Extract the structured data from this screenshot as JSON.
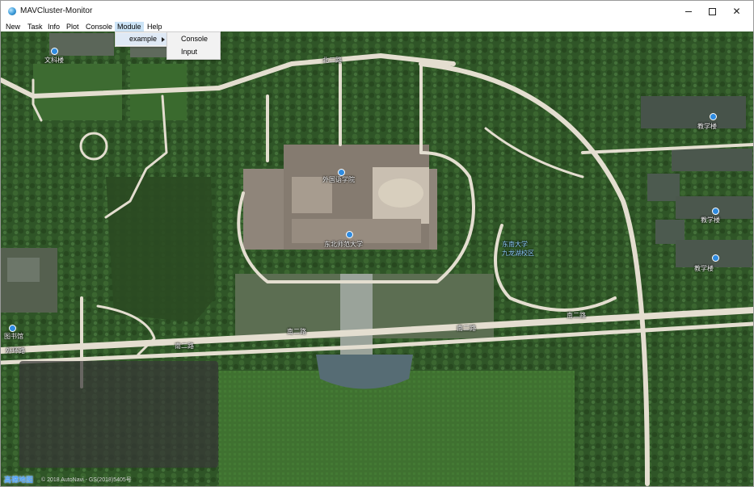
{
  "window": {
    "title": "MAVCluster-Monitor",
    "controls": {
      "minimize": "—",
      "maximize": "☐",
      "close": "✕"
    }
  },
  "menubar": {
    "items": [
      {
        "label": "New"
      },
      {
        "label": "Task"
      },
      {
        "label": "Info"
      },
      {
        "label": "Plot"
      },
      {
        "label": "Console"
      },
      {
        "label": "Module",
        "active": true
      },
      {
        "label": "Help"
      }
    ]
  },
  "module_menu": {
    "items": [
      {
        "label": "example",
        "has_submenu": true
      }
    ],
    "submenu": {
      "items": [
        {
          "label": "Console"
        },
        {
          "label": "Input"
        }
      ]
    }
  },
  "map": {
    "labels": {
      "building_left": "文科楼",
      "north_road": "北二路",
      "library_top": "外国语学院",
      "library_bottom": "东北师范大学",
      "campus": "东南大学\n九龙湖校区",
      "teaching_1": "教学楼",
      "teaching_2": "教学楼",
      "teaching_3": "教学楼",
      "south_road_1": "南二路",
      "south_road_2": "南二路",
      "east_road": "南二路",
      "west_road": "南二路",
      "left_building": "图书馆",
      "outer_road": "外环路"
    },
    "logo": "高德地图",
    "copyright": "© 2018 AutoNavi - GS(2018)5405号"
  },
  "colors": {
    "menu_highlight": "#cce4f7",
    "grass": "#3e6a2c",
    "road": "#e4ded0",
    "overlay": "rgba(55,55,55,0.72)"
  }
}
